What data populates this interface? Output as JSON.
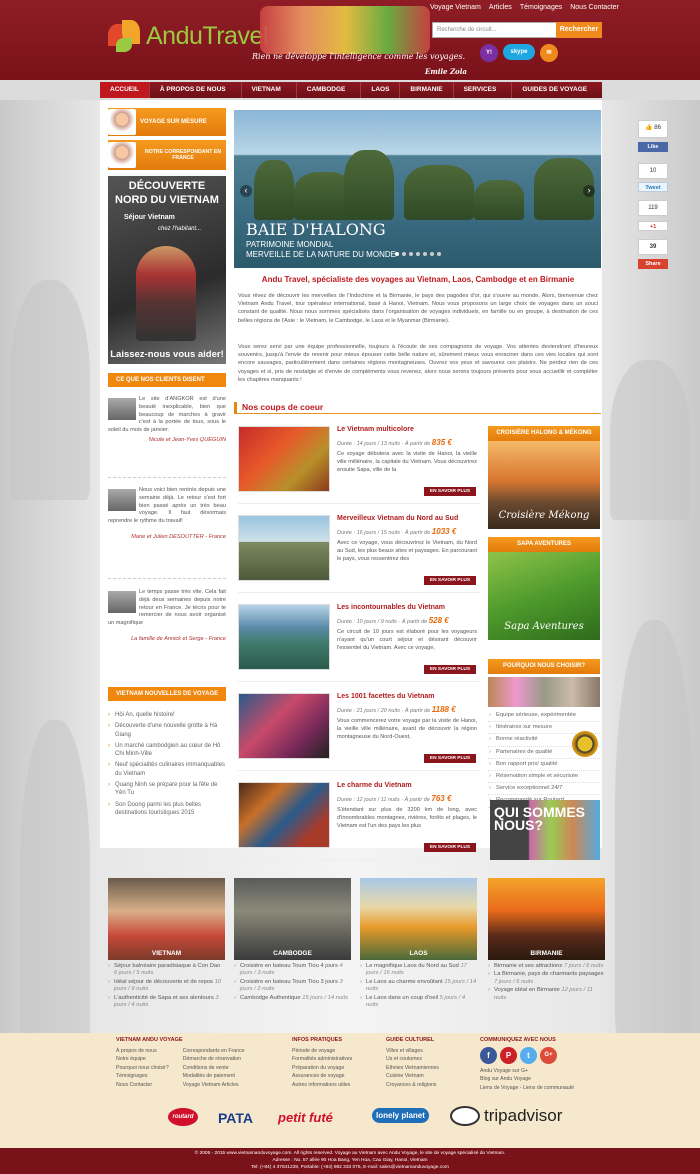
{
  "header": {
    "logo_main": "Andu",
    "logo_sub": "Travel",
    "quote": "Rien ne développe l'intelligence comme les voyages.",
    "quote_author": "Emile Zola",
    "top_links": [
      "Voyage Vietnam",
      "Articles",
      "Témoignages",
      "Nous Contacter"
    ],
    "search_placeholder": "Recherche de circuit...",
    "search_button": "Rechercher",
    "social_icons": [
      "yahoo-icon",
      "skype-icon",
      "mail-icon"
    ],
    "skype_label": "skype"
  },
  "nav": {
    "items": [
      "ACCUEIL",
      "À PROPOS DE NOUS",
      "VIETNAM",
      "CAMBODGE",
      "LAOS",
      "BIRMANIE",
      "SERVICES",
      "GUIDES DE VOYAGE"
    ],
    "dropdown": [
      false,
      true,
      true,
      true,
      false,
      false,
      true,
      true
    ],
    "active": 0
  },
  "sidebar": {
    "btn_mesure": "VOYAGE SUR MESURE",
    "btn_correspondant": "NOTRE CORRESPONDANT EN FRANCE",
    "promo": {
      "line1": "DÉCOUVERTE",
      "line2": "NORD DU VIETNAM",
      "line3": "Séjour Vietnam",
      "line4": "chez l'habitant...",
      "caption": "Laissez-nous vous aider!"
    },
    "clients_title": "CE QUE NOS CLIENTS DISENT",
    "testimonials": [
      {
        "text": "Le site d'ANGKOR est d'une beauté inexplicable, bien que beaucoup de marches à gravir c'est à la portée de tous, sous le soleil du mois de janvier.",
        "sig": "Nicole et Jean-Yves QUEGUIN"
      },
      {
        "text": "Nous voici bien rentrés depuis une semaine déjà. Le retour s'est fort bien passé après un très beau voyage. Il faut désormais reprendre le rythme du travail!",
        "sig": "Marie et Julien DESOUTTER - France"
      },
      {
        "text": "Le temps passe très vite. Cela fait déjà deux semaines depuis notre retour en France. Je técris pour te remercier de nous avoir organisé un magnifique",
        "sig": "La famille de Annick et Serge - France"
      }
    ],
    "news_title": "VIETNAM NOUVELLES DE VOYAGE",
    "news": [
      "Hội An, quelle histoire!",
      "Découverte d'une nouvelle grotte à Hà Giang",
      "Un marché cambodgien au cœur de Hô Chi Minh-Ville",
      "Neuf spécialités culinaires immanquables du Vietnam",
      "Quang Ninh se prépare pour la fête de Yên Tu",
      "Son Doong parmi les plus belles destinations touristiques 2015"
    ]
  },
  "slider": {
    "title": "BAIE D'HALONG",
    "subtitle1": "PATRIMOINE MONDIAL",
    "subtitle2": "MERVEILLE DE LA NATURE DU MONDE",
    "dot_count": 7,
    "active_dot": 0
  },
  "intro": {
    "title": "Andu Travel, spécialiste des voyages au Vietnam, Laos, Cambodge et en Birmanie",
    "p1": "Vous rêvez de découvrir les merveilles de l'Indochine et la Birmanie, le pays des pagodes d'or, qui s'ouvre au monde. Alors, bienvenue chez Vietnam Andu Travel, tour opérateur international, basé à Hanoi, Vietnam. Nous vous proposons un large choix de voyages dans un souci constant de qualité. Nous nous sommes spécialisés dans l'organisation de voyages individuels, en famille ou en groupe, à destination de ces belles régions de l'Asie : le Vietnam, le Cambodge, le Laos et le Myanmar (Birmanie).",
    "p2": "Vous serez servi par une équipe professionnelle, toujours à l'écoute de ses compagnons de voyage. Vos attentes deviendront d'heureux souvenirs, jusqu'à l'envie de revenir pour mieux épouser cette belle nature et, sûrement mieux vous enraciner dans ces vies locales qui sont encore sauvages, particulièrement dans certaines régions montagneuses. Ouvrez vos yeux et savourez ces plaisirs. Ne perdez rien de ces voyages et si, pris de nostalgie et d'envie de compléments vous revenez, alors nous serons toujours présents pour vous accueillir et compléter les chapitres manquants !"
  },
  "coups": {
    "title": "Nos coups de coeur",
    "more": "EN SAVOIR PLUS",
    "duree": "Durée :",
    "from": "À partir de",
    "items": [
      {
        "title": "Le Vietnam multicolore",
        "duration": "14 jours / 13 nuits",
        "price": "835 €",
        "desc": "Ce voyage débutera avec la visite de Hanoi, la vieille ville millénaire, la capitale du Vietnam. Vous découvrirez ensuite Sapa, ville de la"
      },
      {
        "title": "Merveilleux Vietnam du Nord au Sud",
        "duration": "16 jours / 15 nuits",
        "price": "1033 €",
        "desc": "Avec ce voyage, vous découvrirez le Vietnam, du Nord au Sud, les plus beaux sites et paysages. En parcourant le pays, vous ressentirez des"
      },
      {
        "title": "Les incontournables du Vietnam",
        "duration": "10 jours / 9 nuits",
        "price": "528 €",
        "desc": "Ce circuit de 10 jours est élaboré pour les voyageurs n'ayant qu'un court séjour et désirant découvrir l'essentiel du Vietnam. Avec ce voyage,"
      },
      {
        "title": "Les 1001 facettes du Vietnam",
        "duration": "21 jours / 20 nuits",
        "price": "1188 €",
        "desc": "Vous commencerez votre voyage par la visite de Hanoi, la vieille ville millénaire, avant de découvrir la région montagneuse du Nord-Ouest,"
      },
      {
        "title": "Le charme du Vietnam",
        "duration": "12 jours / 11 nuits",
        "price": "763 €",
        "desc": "S'étendant sur plus de 3200 km de long, avec d'innombrables montagnes, rivières, forêts et plages, le Vietnam est l'un des pays les plus"
      }
    ]
  },
  "right": {
    "croisiere_title": "CROISIÈRE HALONG & MÉKONG",
    "croisiere_caption": "Croisière Mékong",
    "sapa_title": "SAPA AVENTURES",
    "sapa_caption": "Sapa Aventures",
    "why_title": "POURQUOI NOUS CHOISIR?",
    "why_items": [
      "Equipe sérieuse, expérimentée",
      "Itinéraires sur mesure",
      "Bonne réactivité",
      "Partenaires de qualité",
      "Bon rapport prix/ qualité",
      "Réservation simple et sécurisée",
      "Service exceptionnel 24/7",
      "Recommandé sur Routard..."
    ],
    "qui_text": "QUI SOMMES NOUS?"
  },
  "social": {
    "like_count": "86",
    "like_label": "Like",
    "tweet_count": "10",
    "tweet_label": "Tweet",
    "gplus_label": "+1",
    "gplus_count": "119",
    "share_count": "39",
    "share_label": "Share"
  },
  "regions": [
    {
      "name": "VIETNAM",
      "items": [
        {
          "t": "Séjour balnéaire paradisiaque à Con Dao",
          "d": "6 jours / 5 nuits"
        },
        {
          "t": "Idéal séjour de découverte et de repos",
          "d": "10 jours / 9 nuits"
        },
        {
          "t": "L'authenticité de Sapa et ses alentours",
          "d": "3 jours / 4 nuits"
        }
      ]
    },
    {
      "name": "CAMBODGE",
      "items": [
        {
          "t": "Croisière en bateau Toum Tiou 4 jours",
          "d": "4 jours / 3 nuits"
        },
        {
          "t": "Croisière en bateau Toum Tiou 3 jours",
          "d": "3 jours / 2 nuits"
        },
        {
          "t": "Cambodge Authentique",
          "d": "15 jours / 14 nuits"
        }
      ]
    },
    {
      "name": "LAOS",
      "items": [
        {
          "t": "Le magnifique Laos du Nord au Sud",
          "d": "17 jours / 16 nuits"
        },
        {
          "t": "Le Laos au charme envoûtant",
          "d": "15 jours / 14 nuits"
        },
        {
          "t": "Le Laos dans un coup d'oeil",
          "d": "5 jours / 4 nuits"
        }
      ]
    },
    {
      "name": "BIRMANIE",
      "items": [
        {
          "t": "Birmanie et ses attractions",
          "d": "7 jours / 6 nuits"
        },
        {
          "t": "La Birmanie, pays de charmants paysages",
          "d": "7 jours / 6 nuits"
        },
        {
          "t": "Voyage idéal en Birmanie",
          "d": "12 jours / 11 nuits"
        }
      ]
    }
  ],
  "footer": {
    "col1_title": "VIETNAM ANDU VOYAGE",
    "col1_a": [
      "À propos de nous",
      "Notre équipe",
      "Pourquoi nous choisir?",
      "Témoignages",
      "Nous Contacter"
    ],
    "col1_b": [
      "Correspondants en France",
      "Démarche de réservation",
      "Conditions de vente",
      "Modalités de paiement",
      "Voyage Vietnam Articles"
    ],
    "col2_title": "INFOS PRATIQUES",
    "col2": [
      "Période de voyage",
      "Formalités administratives",
      "Préparation du voyage",
      "Assurances de voyage",
      "Autres informations utiles"
    ],
    "col3_title": "GUIDE CULTUREL",
    "col3": [
      "Villes et villages",
      "Us et coutumes",
      "Ethnies Vietnamiennes",
      "Cuisine Vietnam",
      "Croyances & religions"
    ],
    "col4_title": "COMMUNIQUEZ AVEC NOUS",
    "col4": [
      "Andu Voyage sur G+",
      "Blog sur Andu Voyage",
      "Liens de Voyage - Liens de communauté"
    ],
    "partners": [
      "routard",
      "PATA",
      "petit futé",
      "lonely planet",
      "tripadvisor"
    ],
    "copyright": "© 2005 - 2015 www.vietnamanduvoyage.com. All rights reserved. Voyage au Vietnam avec Andu Voyage, le site de voyage spécialisé du Vietnam.",
    "address": "Adresse : No. 57 allée 90 Hoa Bang, Yen Hoa, Cau Giay, Hanoi, Vietnam",
    "contact": "Tel: (+84) 4 37841239, Portable: (+84) 982 333 076, E-mail: sales@vietnamanduvoyage.com"
  }
}
